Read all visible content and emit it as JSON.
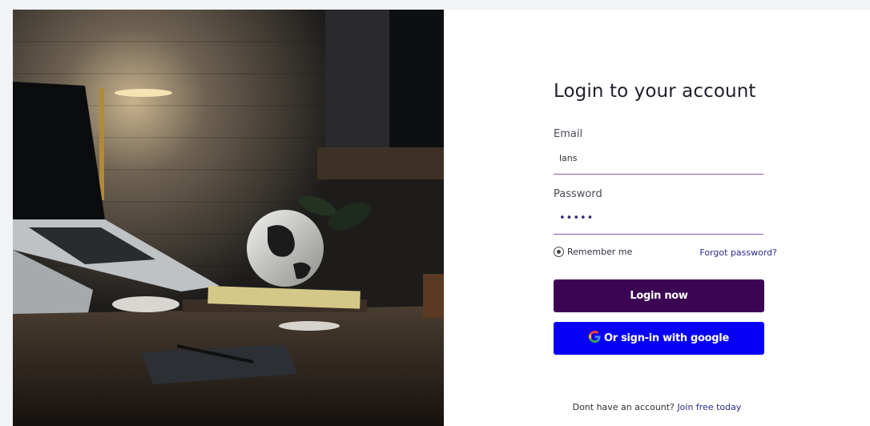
{
  "login": {
    "title": "Login to your account",
    "email_label": "Email",
    "email_value": "lans",
    "password_label": "Password",
    "password_value": "•••••",
    "remember_label": "Remember me",
    "forgot_label": "Forgot password?",
    "login_button": "Login now",
    "google_button": "Or sign-in with google",
    "signup_prompt": "Dont have an account?",
    "signup_link": "Join free today"
  },
  "colors": {
    "login_button_bg": "#3b0553",
    "google_button_bg": "#0700f4",
    "input_underline": "#8a56a8",
    "link": "#2a2a8a"
  },
  "icons": [
    "google-g-icon",
    "radio-icon"
  ]
}
